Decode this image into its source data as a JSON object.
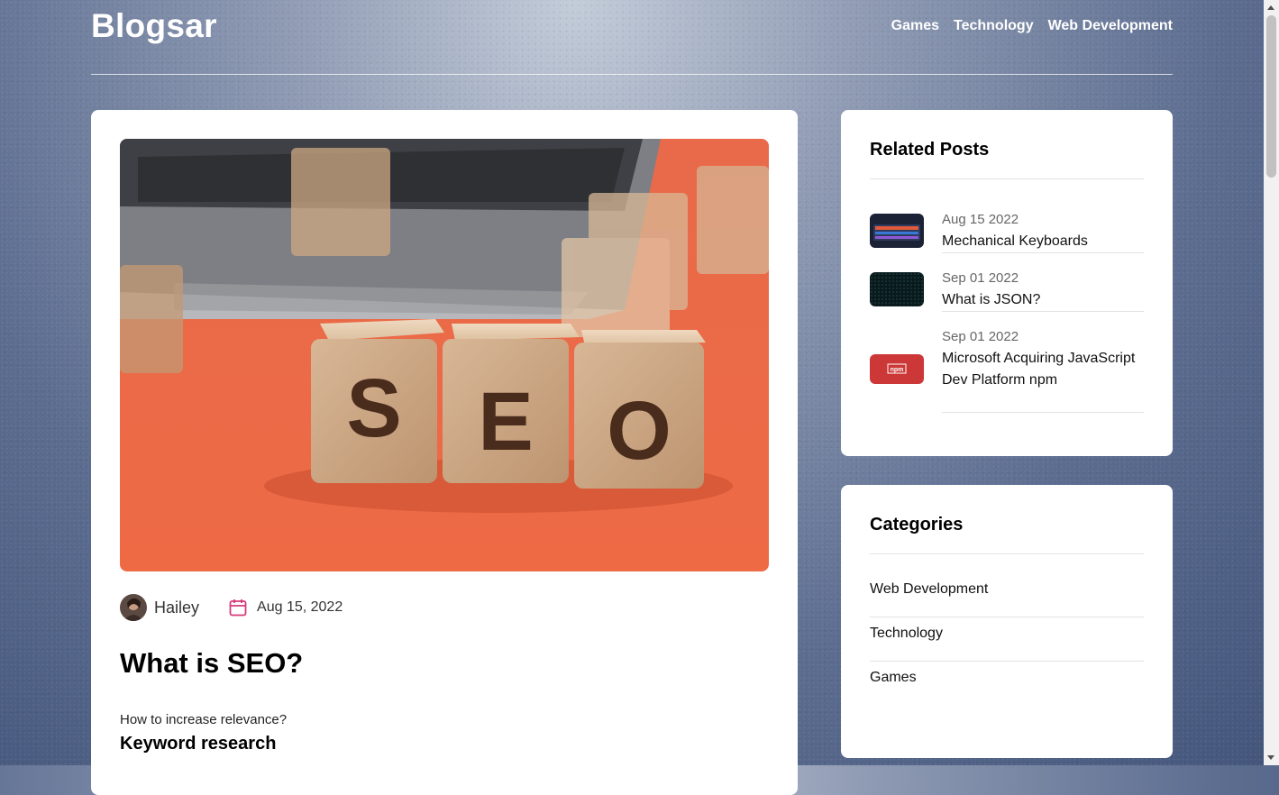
{
  "site": {
    "logo": "Blogsar"
  },
  "nav": [
    "Games",
    "Technology",
    "Web Development"
  ],
  "post": {
    "hero_image": "seo-wooden-cubes-photo",
    "author": "Hailey",
    "date": "Aug 15, 2022",
    "title": "What is SEO?",
    "intro": "How to increase relevance?",
    "section_heading": "Keyword research"
  },
  "related": {
    "title": "Related Posts",
    "items": [
      {
        "date": "Aug 15 2022",
        "title": "Mechanical Keyboards",
        "thumb": "keyboard-photo"
      },
      {
        "date": "Sep 01 2022",
        "title": "What is JSON?",
        "thumb": "dark-pattern-image"
      },
      {
        "date": "Sep 01 2022",
        "title": "Microsoft Acquiring JavaScript Dev Platform npm",
        "thumb": "npm-logo",
        "thumb_text": "npm"
      }
    ]
  },
  "categories": {
    "title": "Categories",
    "items": [
      "Web Development",
      "Technology",
      "Games"
    ]
  },
  "colors": {
    "accent": "#d63a7a",
    "npm_red": "#cb3837"
  }
}
